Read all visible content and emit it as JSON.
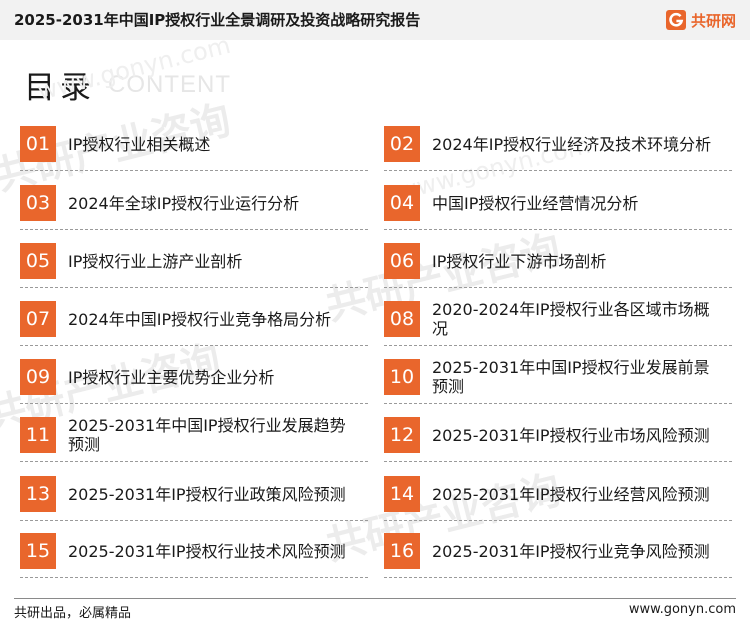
{
  "header": {
    "title": "2025-2031年中国IP授权行业全景调研及投资战略研究报告",
    "logo_text": "共研网",
    "logo_icon": "gonyn-logo-icon",
    "accent_color": "#e9662c",
    "bar_color": "#f2f2f2"
  },
  "heading": {
    "title": "目录",
    "subtitle": "CONTENT"
  },
  "toc": [
    {
      "num": "01",
      "label": "IP授权行业相关概述"
    },
    {
      "num": "02",
      "label": "2024年IP授权行业经济及技术环境分析"
    },
    {
      "num": "03",
      "label": "2024年全球IP授权行业运行分析"
    },
    {
      "num": "04",
      "label": "中国IP授权行业经营情况分析"
    },
    {
      "num": "05",
      "label": "IP授权行业上游产业剖析"
    },
    {
      "num": "06",
      "label": "IP授权行业下游市场剖析"
    },
    {
      "num": "07",
      "label": "2024年中国IP授权行业竞争格局分析"
    },
    {
      "num": "08",
      "label": "2020-2024年IP授权行业各区域市场概况"
    },
    {
      "num": "09",
      "label": "IP授权行业主要优势企业分析"
    },
    {
      "num": "10",
      "label": "2025-2031年中国IP授权行业发展前景预测"
    },
    {
      "num": "11",
      "label": "2025-2031年中国IP授权行业发展趋势预测"
    },
    {
      "num": "12",
      "label": "2025-2031年IP授权行业市场风险预测"
    },
    {
      "num": "13",
      "label": "2025-2031年IP授权行业政策风险预测"
    },
    {
      "num": "14",
      "label": "2025-2031年IP授权行业经营风险预测"
    },
    {
      "num": "15",
      "label": "2025-2031年IP授权行业技术风险预测"
    },
    {
      "num": "16",
      "label": "2025-2031年IP授权行业竞争风险预测"
    }
  ],
  "watermark": {
    "text_cn": "共研产业咨询",
    "text_en": "www.gonyn.com"
  },
  "footer": {
    "left": "共研出品，必属精品",
    "right": "www.gonyn.com"
  }
}
